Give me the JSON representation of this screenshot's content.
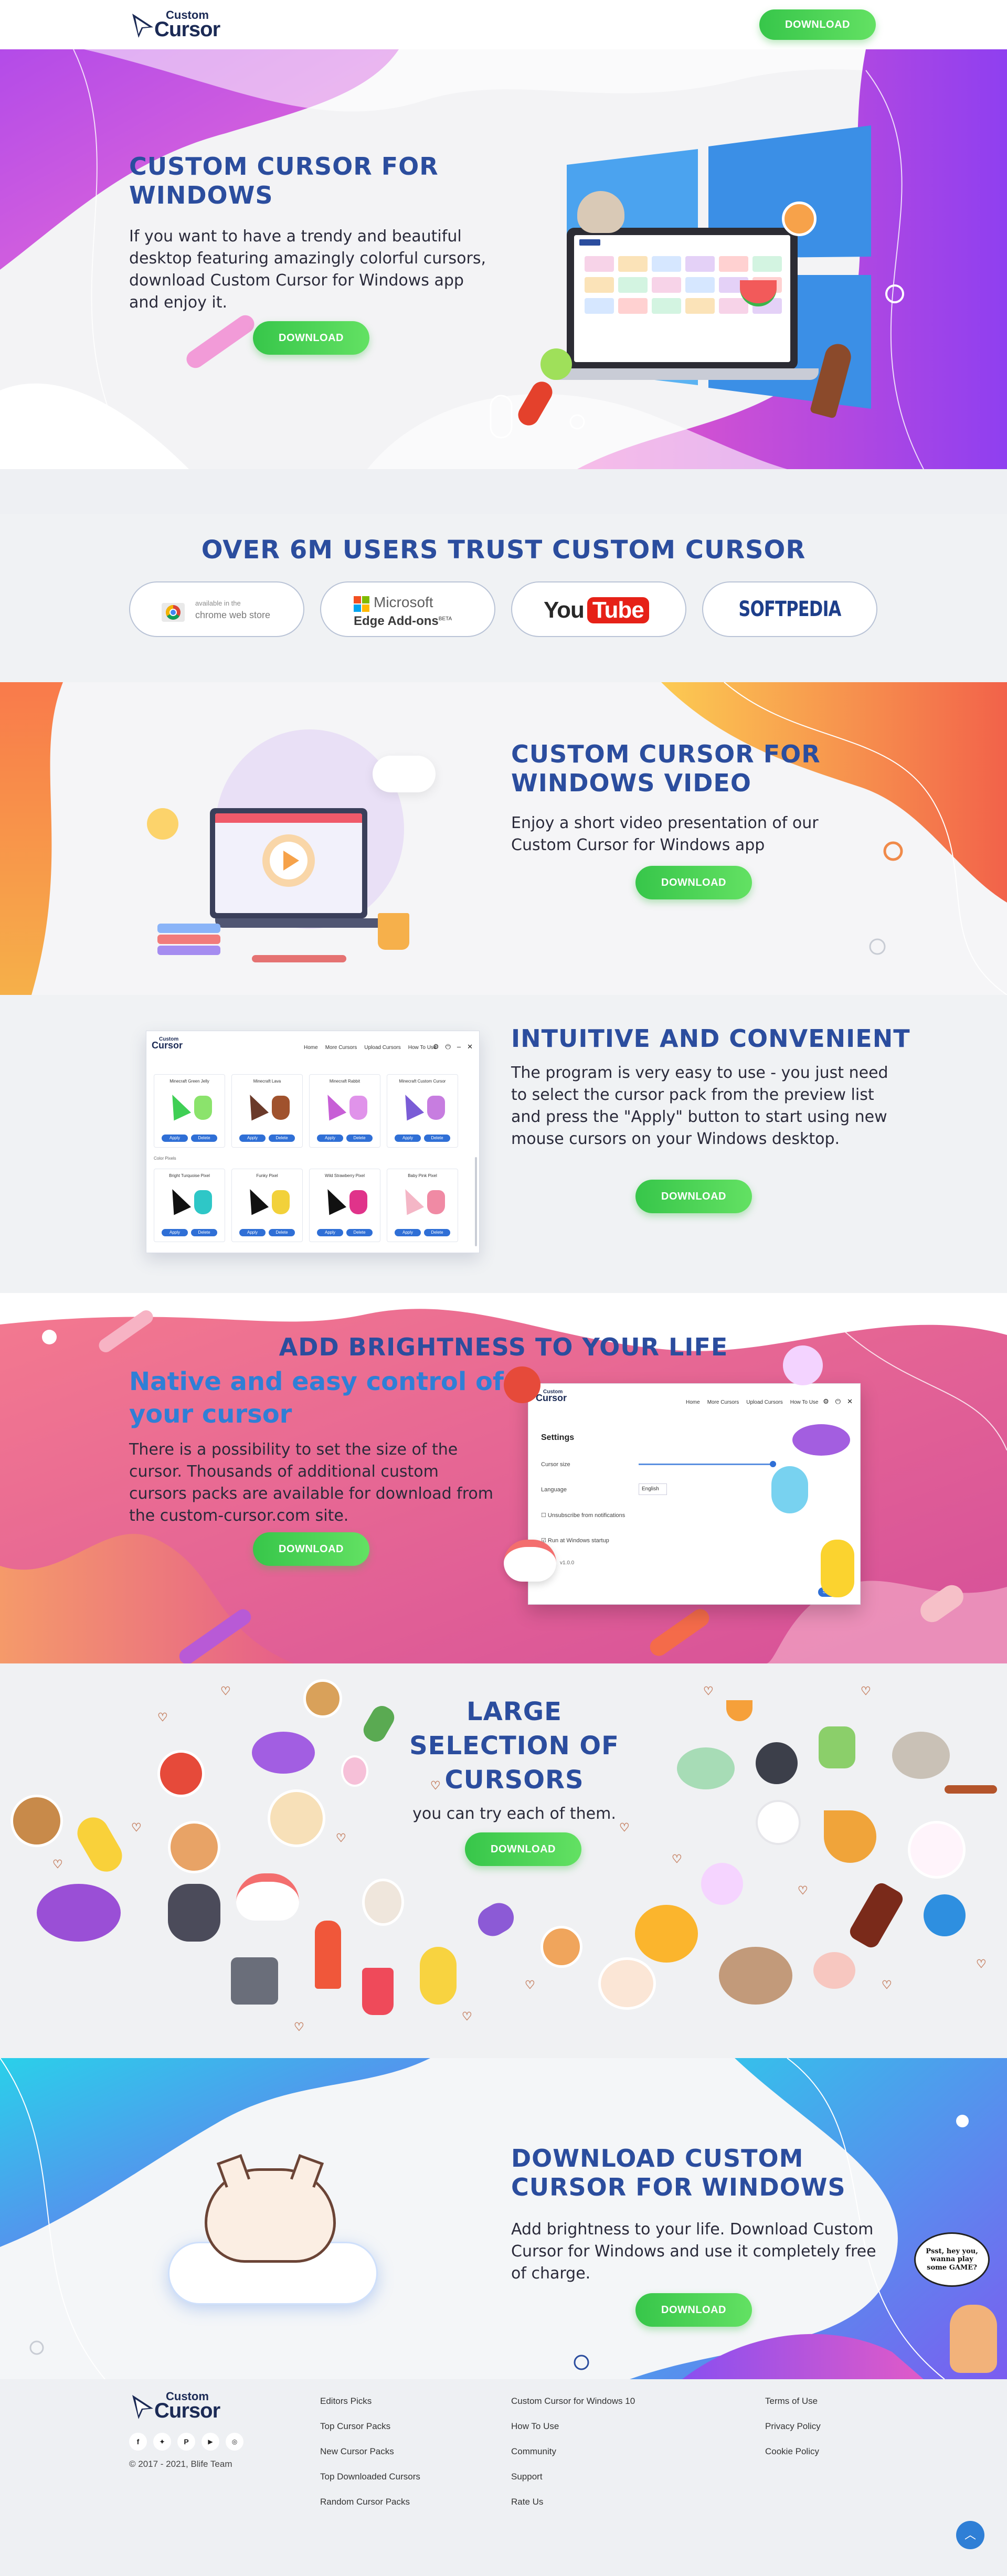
{
  "header": {
    "logo_top": "Custom",
    "logo_bottom": "Cursor",
    "download_label": "DOWNLOAD"
  },
  "hero": {
    "title": "CUSTOM CURSOR FOR WINDOWS",
    "description": "If you want to have a trendy and beautiful desktop featuring amazingly colorful cursors, download Custom Cursor for Windows app and enjoy it.",
    "download_label": "DOWNLOAD"
  },
  "trust": {
    "title": "OVER 6M USERS TRUST CUSTOM CURSOR",
    "badges": [
      {
        "name": "chrome-web-store",
        "line1": "available in the",
        "line2": "chrome web store"
      },
      {
        "name": "edge-addons",
        "line1": "Microsoft",
        "line2": "Edge Add-ons",
        "sup": "BETA"
      },
      {
        "name": "youtube",
        "line1": "You",
        "line2": "Tube"
      },
      {
        "name": "softpedia",
        "line1": "SOFTPEDIA"
      }
    ]
  },
  "video": {
    "title": "CUSTOM CURSOR FOR WINDOWS VIDEO",
    "description": "Enjoy a short video presentation of our Custom Cursor for Windows app",
    "download_label": "DOWNLOAD"
  },
  "intuitive": {
    "title": "INTUITIVE AND CONVENIENT",
    "description": "The program is very easy to use - you just need to select the cursor pack from the preview list and press the \"Apply\" button to start using new mouse cursors on your Windows desktop.",
    "download_label": "DOWNLOAD",
    "app": {
      "logo_top": "Custom",
      "logo_bottom": "Cursor",
      "nav": [
        "Home",
        "More Cursors",
        "Upload Cursors",
        "How To Use"
      ],
      "section_label": "Color Pixels",
      "packs": [
        {
          "name": "Minecraft Green Jelly",
          "c1": "#3fcf55",
          "c2": "#8be36c"
        },
        {
          "name": "Minecraft Lava",
          "c1": "#6b3a2a",
          "c2": "#a0522d"
        },
        {
          "name": "Minecraft Rabbit",
          "c1": "#c75fd6",
          "c2": "#e093ea"
        },
        {
          "name": "Minecraft Custom Cursor",
          "c1": "#7a5cd6",
          "c2": "#c77de0"
        },
        {
          "name": "Bright Turquoise Pixel",
          "c1": "#111111",
          "c2": "#2ec7c7"
        },
        {
          "name": "Funky Pixel",
          "c1": "#111111",
          "c2": "#f2d13a"
        },
        {
          "name": "Wild Strawberry Pixel",
          "c1": "#111111",
          "c2": "#e0338a"
        },
        {
          "name": "Baby Pink Pixel",
          "c1": "#f4b6c6",
          "c2": "#f08aa4"
        }
      ],
      "apply_label": "Apply",
      "delete_label": "Delete"
    }
  },
  "brightness": {
    "title": "ADD BRIGHTNESS TO YOUR LIFE",
    "subtitle": "Native and easy control of your cursor",
    "description": "There is a possibility to set the size of the cursor. Thousands of additional custom cursors packs are available for download from the custom-cursor.com site.",
    "download_label": "DOWNLOAD",
    "settings": {
      "logo_top": "Custom",
      "logo_bottom": "Cursor",
      "nav": [
        "Home",
        "More Cursors",
        "Upload Cursors",
        "How To Use"
      ],
      "title": "Settings",
      "size_label": "Cursor size",
      "language_label": "Language",
      "language_value": "English",
      "unsubscribe_label": "Unsubscribe from notifications",
      "startup_label": "Run at Windows startup",
      "version": "v1.0.0",
      "save_label": "Save"
    }
  },
  "selection": {
    "title": "LARGE SELECTION OF CURSORS",
    "description": "you can try each of them.",
    "download_label": "DOWNLOAD"
  },
  "download_cta": {
    "title": "DOWNLOAD CUSTOM CURSOR FOR WINDOWS",
    "description": "Add brightness to your life. Download Custom Cursor for Windows and use it completely free of charge.",
    "download_label": "DOWNLOAD",
    "speech": "Psst, hey you, wanna play some GAME?"
  },
  "footer": {
    "logo_top": "Custom",
    "logo_bottom": "Cursor",
    "copyright": "© 2017 - 2021, Blife Team",
    "social": [
      "facebook-icon",
      "twitter-icon",
      "pinterest-icon",
      "youtube-icon",
      "vk-icon"
    ],
    "col1": [
      "Editors Picks",
      "Top Cursor Packs",
      "New Cursor Packs",
      "Top Downloaded Cursors",
      "Random Cursor Packs"
    ],
    "col2": [
      "Custom Cursor for Windows 10",
      "How To Use",
      "Community",
      "Support",
      "Rate Us"
    ],
    "col3": [
      "Terms of Use",
      "Privacy Policy",
      "Cookie Policy"
    ]
  },
  "colors": {
    "accent_green": "#3fce4f",
    "heading_blue": "#2b4d9e",
    "subheading_blue": "#2f7fd6",
    "purple": "#a24ee8",
    "pink": "#e052a6",
    "orange": "#f68b46",
    "cyan": "#2ec2ea"
  }
}
